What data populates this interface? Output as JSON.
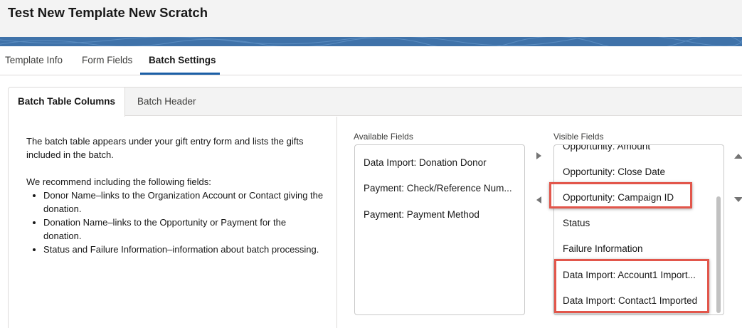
{
  "page": {
    "title": "Test New Template New Scratch"
  },
  "top_tabs": [
    {
      "label": "Template Info"
    },
    {
      "label": "Form Fields"
    },
    {
      "label": "Batch Settings",
      "active": true
    }
  ],
  "card": {
    "tabs": [
      {
        "label": "Batch Table Columns",
        "active": true
      },
      {
        "label": "Batch Header"
      }
    ],
    "description": {
      "intro": "The batch table appears under your gift entry form and lists the gifts included in the batch.",
      "recommend": "We recommend including the following fields:",
      "bullets": [
        "Donor Name–links to the Organization Account or Contact giving the donation.",
        "Donation Name–links to the Opportunity or Payment for the donation.",
        "Status and Failure Information–information about batch processing."
      ]
    },
    "available": {
      "label": "Available Fields",
      "items": [
        "Data Import: Donation Donor",
        "Payment: Check/Reference Num...",
        "Payment: Payment Method"
      ]
    },
    "visible": {
      "label": "Visible Fields",
      "items": [
        "Opportunity: Amount",
        "Opportunity: Close Date",
        "Opportunity: Campaign ID",
        "Status",
        "Failure Information",
        "Data Import: Account1 Import...",
        "Data Import: Contact1 Imported"
      ]
    }
  },
  "colors": {
    "brand_band": "#3f72a9",
    "active_tab_underline": "#1b5fa6",
    "highlight": "#e2564b"
  }
}
